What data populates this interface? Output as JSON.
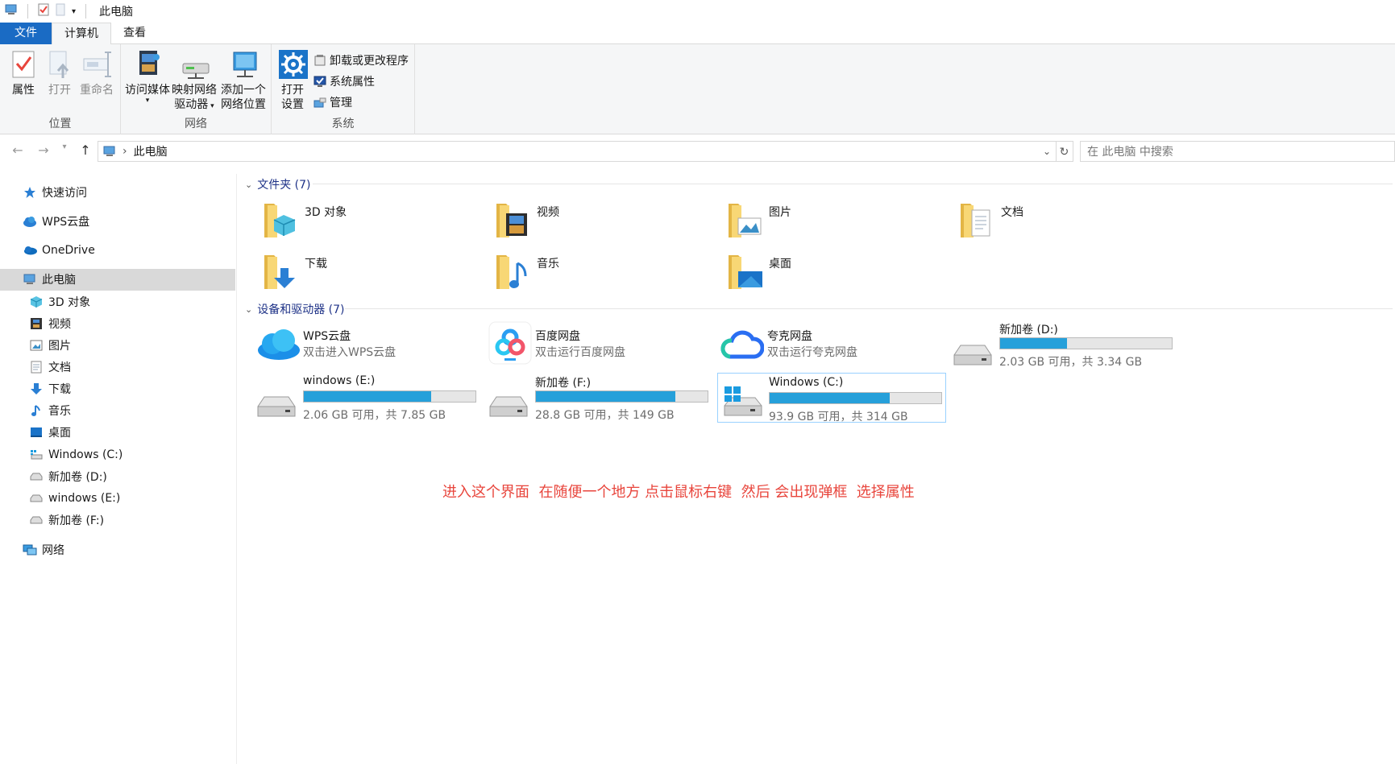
{
  "window": {
    "title": "此电脑"
  },
  "ribbon": {
    "tabs": [
      "文件",
      "计算机",
      "查看"
    ],
    "location": {
      "label": "位置",
      "props": "属性",
      "open": "打开",
      "rename": "重命名"
    },
    "network": {
      "label": "网络",
      "media": "访问媒体",
      "map_drive_1": "映射网络",
      "map_drive_2": "驱动器",
      "add_loc_1": "添加一个",
      "add_loc_2": "网络位置"
    },
    "system": {
      "label": "系统",
      "open_settings_1": "打开",
      "open_settings_2": "设置",
      "uninstall": "卸载或更改程序",
      "sys_props": "系统属性",
      "manage": "管理"
    }
  },
  "address": {
    "path": "此电脑",
    "search_placeholder": "在 此电脑 中搜索"
  },
  "sidebar": {
    "quick": "快速访问",
    "wps": "WPS云盘",
    "onedrive": "OneDrive",
    "thispc": "此电脑",
    "items": [
      "3D 对象",
      "视频",
      "图片",
      "文档",
      "下载",
      "音乐",
      "桌面",
      "Windows  (C:)",
      "新加卷 (D:)",
      "windows (E:)",
      "新加卷 (F:)"
    ],
    "network": "网络"
  },
  "folders_header": "文件夹 (7)",
  "folders": [
    "3D 对象",
    "视频",
    "图片",
    "文档",
    "下载",
    "音乐",
    "桌面"
  ],
  "devices_header": "设备和驱动器 (7)",
  "cloud": [
    {
      "name": "WPS云盘",
      "desc": "双击进入WPS云盘"
    },
    {
      "name": "百度网盘",
      "desc": "双击运行百度网盘"
    },
    {
      "name": "夸克网盘",
      "desc": "双击运行夸克网盘"
    }
  ],
  "drives": [
    {
      "name": "新加卷 (D:)",
      "size": "2.03 GB 可用，共 3.34 GB",
      "used_fraction": 0.39
    },
    {
      "name": "windows (E:)",
      "size": "2.06 GB 可用，共 7.85 GB",
      "used_fraction": 0.74
    },
    {
      "name": "新加卷 (F:)",
      "size": "28.8 GB 可用，共 149 GB",
      "used_fraction": 0.81
    },
    {
      "name": "Windows  (C:)",
      "size": "93.9 GB 可用，共 314 GB",
      "used_fraction": 0.7
    }
  ],
  "annotation": "进入这个界面  在随便一个地方 点击鼠标右键  然后 会出现弹框  选择属性"
}
